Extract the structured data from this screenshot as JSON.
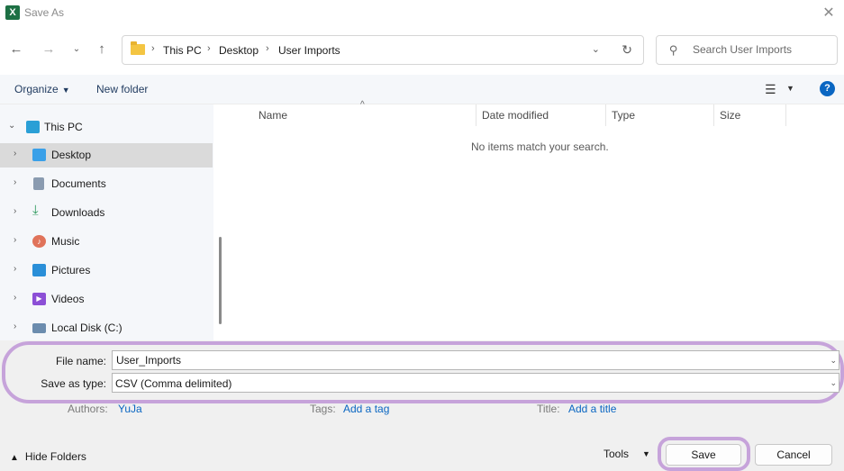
{
  "window": {
    "title": "Save As",
    "app_icon": "excel-icon"
  },
  "address_bar": {
    "crumbs": [
      "This PC",
      "Desktop",
      "User Imports"
    ],
    "search_placeholder": "Search User Imports"
  },
  "toolbar": {
    "organize_label": "Organize",
    "new_folder_label": "New folder",
    "help_label": "?"
  },
  "nav_tree": {
    "items": [
      {
        "label": "This PC",
        "icon": "pc-icon",
        "color": "#2a9fd6"
      },
      {
        "label": "Desktop",
        "icon": "desktop-icon",
        "color": "#3aa0e8"
      },
      {
        "label": "Documents",
        "icon": "documents-icon",
        "color": "#8a9bb0"
      },
      {
        "label": "Downloads",
        "icon": "downloads-icon",
        "color": "#2e9a5e"
      },
      {
        "label": "Music",
        "icon": "music-icon",
        "color": "#e0735a"
      },
      {
        "label": "Pictures",
        "icon": "pictures-icon",
        "color": "#2a8fd8"
      },
      {
        "label": "Videos",
        "icon": "videos-icon",
        "color": "#8c4fd6"
      },
      {
        "label": "Local Disk (C:)",
        "icon": "disk-icon",
        "color": "#6b8cae"
      }
    ],
    "selected": "Desktop"
  },
  "file_list": {
    "columns": [
      "Name",
      "Date modified",
      "Type",
      "Size"
    ],
    "empty_message": "No items match your search."
  },
  "save_form": {
    "file_name_label": "File name:",
    "file_name_value": "User_Imports",
    "save_type_label": "Save as type:",
    "save_type_value": "CSV (Comma delimited)",
    "authors_label": "Authors:",
    "authors_value": "YuJa",
    "tags_label": "Tags:",
    "tags_value": "Add a tag",
    "title_label": "Title:",
    "title_value": "Add a title"
  },
  "footer": {
    "hide_folders_label": "Hide Folders",
    "tools_label": "Tools",
    "save_label": "Save",
    "cancel_label": "Cancel"
  },
  "colors": {
    "highlight": "#c6a3da",
    "accent": "#0a66c2"
  }
}
